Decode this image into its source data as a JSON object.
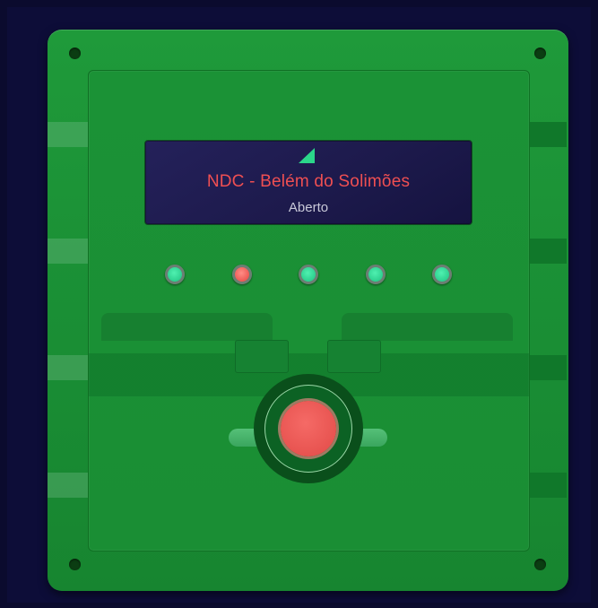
{
  "display": {
    "station_name": "NDC - Belém do Solimões",
    "status": "Aberto",
    "signal_icon": "signal-strength-icon",
    "text_color": "#ef4f52",
    "background_color": "#1d1a4c"
  },
  "indicators": [
    {
      "state": "green",
      "color": "#2ad491"
    },
    {
      "state": "red",
      "color": "#e5433f"
    },
    {
      "state": "green",
      "color": "#2ad491"
    },
    {
      "state": "green",
      "color": "#2ad491"
    },
    {
      "state": "green",
      "color": "#2ad491"
    }
  ],
  "panel": {
    "color": "#1a8f35",
    "background": "#0b0b2e"
  },
  "main_button": {
    "icon": "push-button-icon",
    "color": "#e24a47"
  }
}
